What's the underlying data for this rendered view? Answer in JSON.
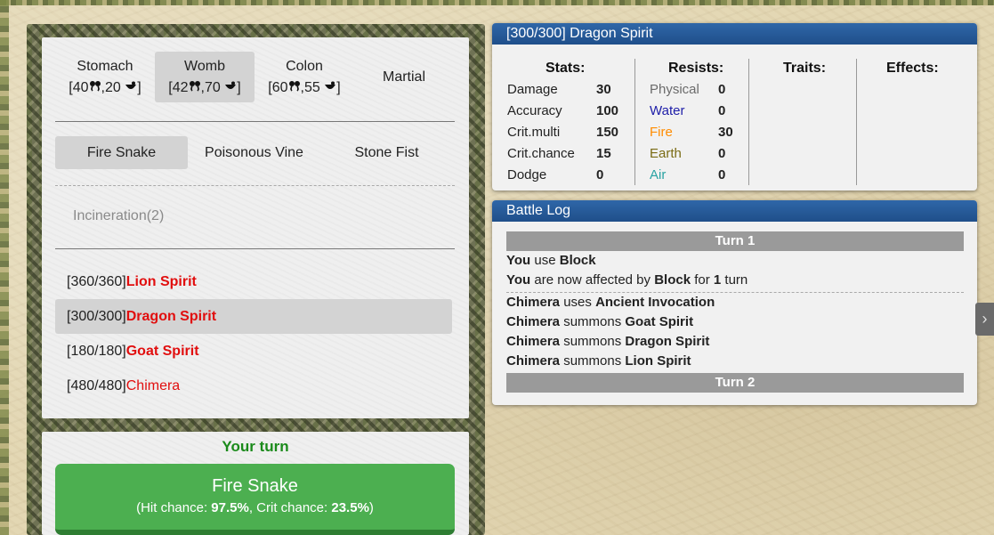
{
  "organs": [
    {
      "name": "Stomach",
      "a": "40",
      "b": "20",
      "active": false
    },
    {
      "name": "Womb",
      "a": "42",
      "b": "70",
      "active": true
    },
    {
      "name": "Colon",
      "a": "60",
      "b": "55",
      "active": false
    },
    {
      "name": "Martial",
      "a": "",
      "b": "",
      "active": false
    }
  ],
  "skills": [
    {
      "label": "Fire Snake",
      "active": true
    },
    {
      "label": "Poisonous Vine",
      "active": false
    },
    {
      "label": "Stone Fist",
      "active": false
    }
  ],
  "sub_skill": "Incineration(2)",
  "targets": [
    {
      "hp": "[360/360]",
      "name": "Lion Spirit",
      "active": false,
      "bold": true
    },
    {
      "hp": "[300/300]",
      "name": "Dragon Spirit",
      "active": true,
      "bold": true
    },
    {
      "hp": "[180/180]",
      "name": "Goat Spirit",
      "active": false,
      "bold": true
    },
    {
      "hp": "[480/480]",
      "name": "Chimera",
      "active": false,
      "bold": false
    }
  ],
  "turn_label": "Your turn",
  "attack": {
    "label": "Fire Snake",
    "hit_prefix": "(Hit chance: ",
    "hit_value": "97.5%",
    "crit_prefix": ", Crit chance: ",
    "crit_value": "23.5%",
    "suffix": ")"
  },
  "info": {
    "title": "[300/300] Dragon Spirit",
    "stats_title": "Stats:",
    "resists_title": "Resists:",
    "traits_title": "Traits:",
    "effects_title": "Effects:",
    "stats": [
      {
        "label": "Damage",
        "value": "30"
      },
      {
        "label": "Accuracy",
        "value": "100"
      },
      {
        "label": "Crit.multi",
        "value": "150"
      },
      {
        "label": "Crit.chance",
        "value": "15"
      },
      {
        "label": "Dodge",
        "value": "0"
      }
    ],
    "resists": [
      {
        "label": "Physical",
        "value": "0",
        "color": "#6b6b6b"
      },
      {
        "label": "Water",
        "value": "0",
        "color": "#1d1da8"
      },
      {
        "label": "Fire",
        "value": "30",
        "color": "#ff8c00"
      },
      {
        "label": "Earth",
        "value": "0",
        "color": "#7a6b14"
      },
      {
        "label": "Air",
        "value": "0",
        "color": "#2aa3a3"
      }
    ]
  },
  "log": {
    "title": "Battle Log",
    "turn1": "Turn 1",
    "turn2": "Turn 2",
    "l1": {
      "s": "You",
      "m": " use ",
      "o": "Block"
    },
    "l2": {
      "s": "You",
      "m": " are now affected by ",
      "o": "Block",
      "m2": " for ",
      "n": "1",
      "m3": " turn"
    },
    "l3": {
      "s": "Chimera",
      "m": " uses ",
      "o": "Ancient Invocation"
    },
    "l4": {
      "s": "Chimera",
      "m": " summons ",
      "o": "Goat Spirit"
    },
    "l5": {
      "s": "Chimera",
      "m": " summons ",
      "o": "Dragon Spirit"
    },
    "l6": {
      "s": "Chimera",
      "m": " summons ",
      "o": "Lion Spirit"
    }
  }
}
